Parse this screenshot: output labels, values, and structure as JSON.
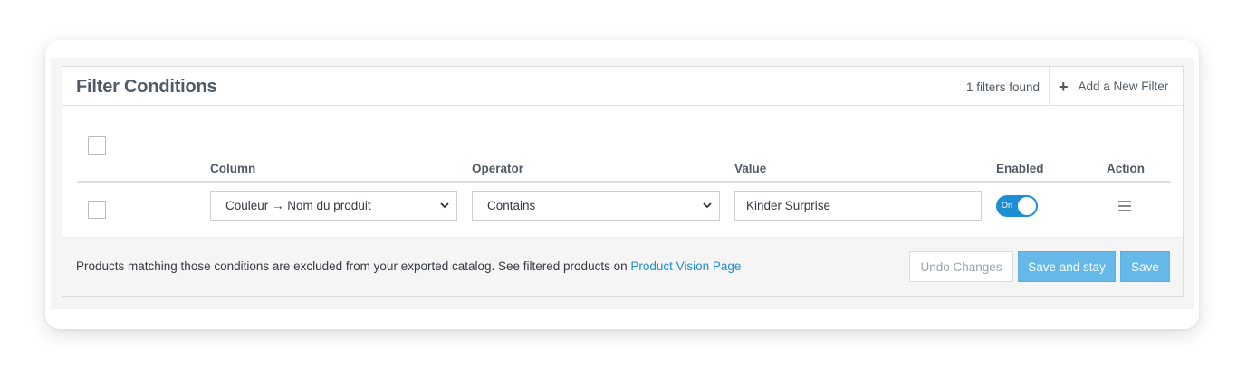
{
  "panel": {
    "title": "Filter Conditions",
    "filters_count": "1 filters found",
    "add_filter_label": "Add a New Filter"
  },
  "table": {
    "headers": {
      "column": "Column",
      "operator": "Operator",
      "value": "Value",
      "enabled": "Enabled",
      "action": "Action"
    },
    "rows": [
      {
        "column": "Couleur → Nom du produit",
        "operator": "Contains",
        "value": "Kinder Surprise",
        "enabled_label": "On"
      }
    ]
  },
  "footer": {
    "text": "Products matching those conditions are excluded from your exported catalog. See filtered products on ",
    "link": "Product Vision Page",
    "undo_label": "Undo Changes",
    "save_stay_label": "Save and stay",
    "save_label": "Save"
  },
  "colors": {
    "accent": "#1e8ed4",
    "button_primary": "#65b8e8",
    "title": "#4f5b66"
  },
  "icons": {
    "add": "plus-icon",
    "select_arrow": "chevron-down-icon",
    "row_action": "menu-icon"
  }
}
